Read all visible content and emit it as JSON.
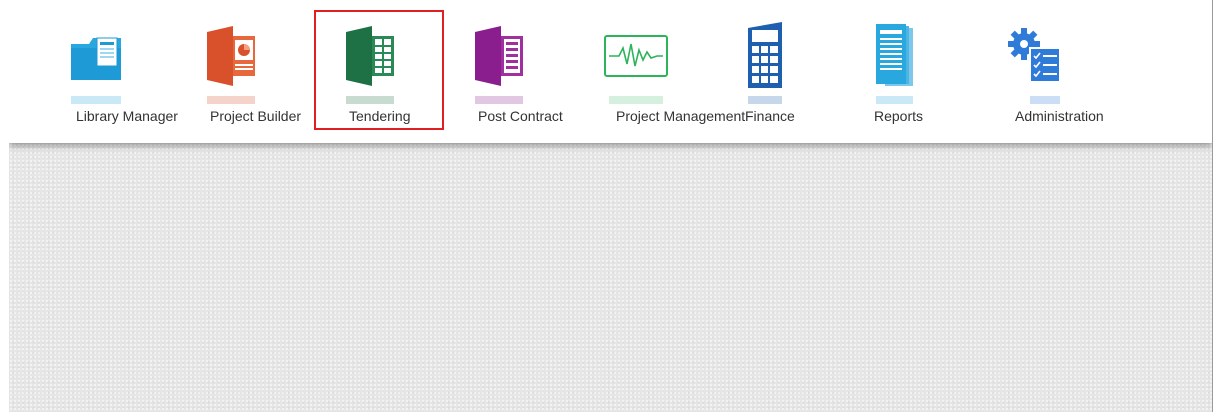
{
  "nav": {
    "items": [
      {
        "label": "Library Manager",
        "icon": "folder-document-icon",
        "color": "#29A8E0"
      },
      {
        "label": "Project Builder",
        "icon": "powerpoint-icon",
        "color": "#D8512A"
      },
      {
        "label": "Tendering",
        "icon": "spreadsheet-icon",
        "color": "#1E7145",
        "selected": true
      },
      {
        "label": "Post Contract",
        "icon": "document-book-icon",
        "color": "#8B1E8E"
      },
      {
        "label": "Project Management",
        "icon": "activity-monitor-icon",
        "color": "#2DB35A"
      },
      {
        "label": "Finance",
        "icon": "calculator-icon",
        "color": "#1F5FAF"
      },
      {
        "label": "Reports",
        "icon": "report-pages-icon",
        "color": "#29A8E0"
      },
      {
        "label": "Administration",
        "icon": "gear-checklist-icon",
        "color": "#2F7BD9"
      }
    ]
  },
  "highlight_color": "#E02020"
}
